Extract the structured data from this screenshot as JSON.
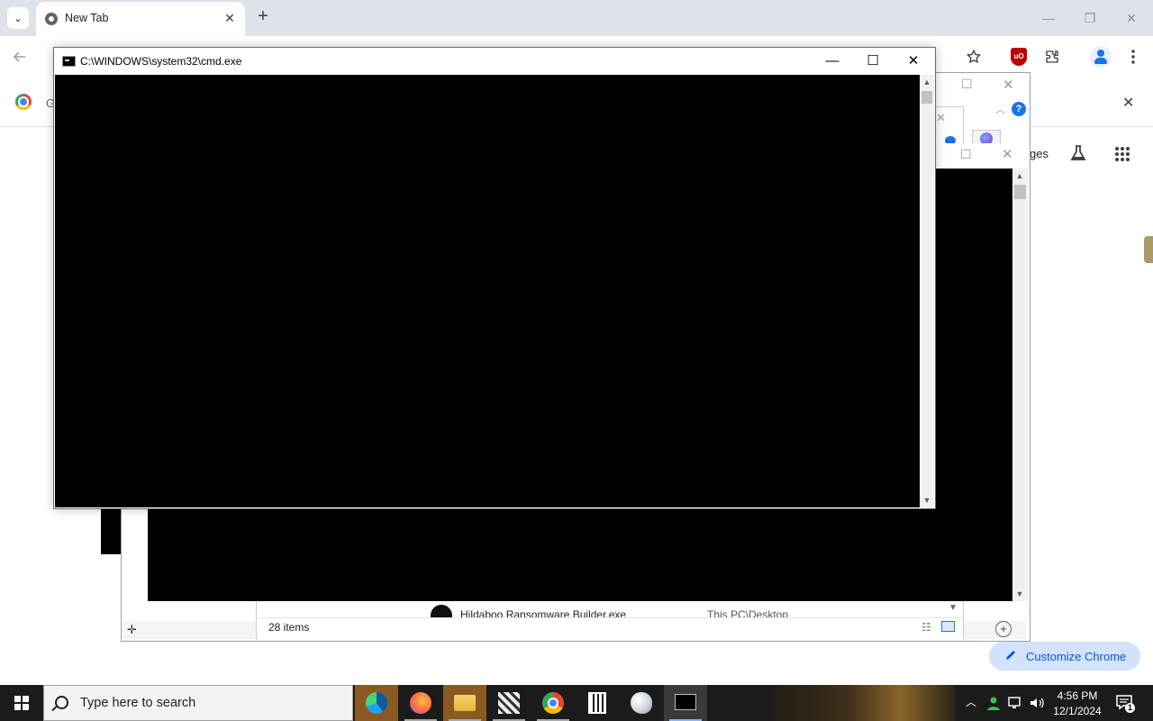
{
  "browser": {
    "tab_title": "New Tab",
    "tab_close": "✕",
    "new_tab": "+",
    "tab_search": "⌄",
    "window_controls": {
      "minimize": "—",
      "restore": "❐",
      "close": "✕"
    },
    "partial_g": "G",
    "apps_text": "ges",
    "infobar_close": "✕",
    "customize_label": "Customize Chrome"
  },
  "cmd": {
    "title": "C:\\WINDOWS\\system32\\cmd.exe",
    "minimize": "—",
    "maximize": "☐",
    "close": "✕"
  },
  "explorer": {
    "status_items": "28 items",
    "file_name": "Hildaboo Ransomware Builder.exe",
    "file_path": "This PC\\Desktop"
  },
  "taskbar": {
    "search_placeholder": "Type here to search",
    "time": "4:56 PM",
    "date": "12/1/2024",
    "notification_count": "1",
    "apps": [
      "edge-icon",
      "firefox-icon",
      "file-explorer-icon",
      "app-icon",
      "chrome-icon",
      "calculator-icon",
      "paint-icon",
      "cmd-icon"
    ]
  },
  "colors": {
    "tabstrip": "#dee3ea",
    "taskbar": "#1b1b1b",
    "console_bg": "#000000",
    "customize_bg": "#d3e3fd"
  }
}
